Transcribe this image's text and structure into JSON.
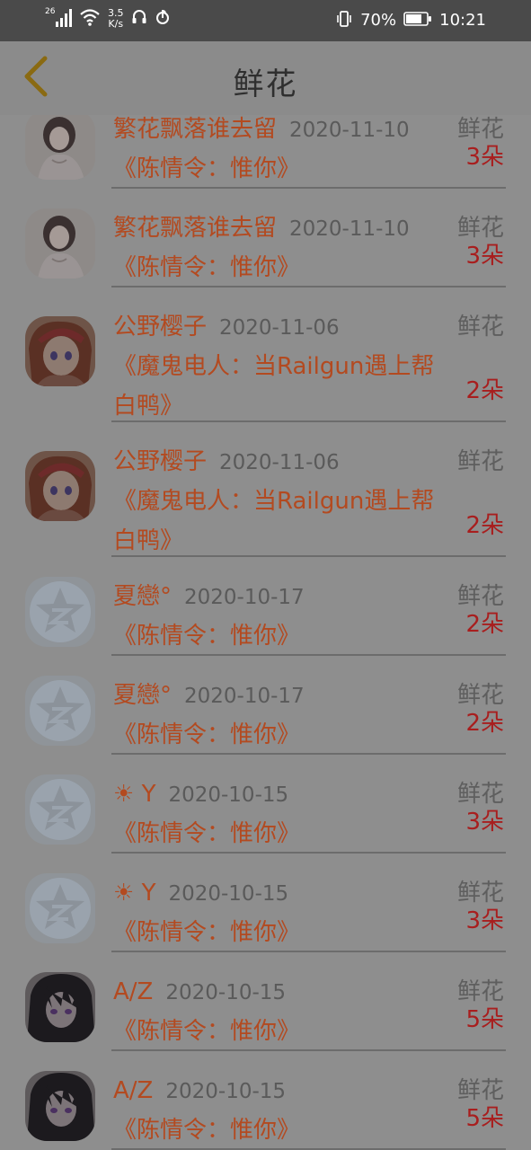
{
  "status_bar": {
    "signal_type": "26",
    "net_speed_value": "3.5",
    "net_speed_unit": "K/s",
    "battery_percent": "70%",
    "time": "10:21"
  },
  "header": {
    "title": "鲜花"
  },
  "records": [
    {
      "name": "繁花飘落谁去留",
      "date": "2020-11-10",
      "type": "鲜花",
      "book": "《陈情令：惟你》",
      "count": "3朵",
      "avatar": "girl-photo"
    },
    {
      "name": "繁花飘落谁去留",
      "date": "2020-11-10",
      "type": "鲜花",
      "book": "《陈情令：惟你》",
      "count": "3朵",
      "avatar": "girl-photo"
    },
    {
      "name": "公野樱子",
      "date": "2020-11-06",
      "type": "鲜花",
      "book": "《魔鬼电人：当Railgun遇上帮白鸭》",
      "count": "2朵",
      "avatar": "anime-girl"
    },
    {
      "name": "公野樱子",
      "date": "2020-11-06",
      "type": "鲜花",
      "book": "《魔鬼电人：当Railgun遇上帮白鸭》",
      "count": "2朵",
      "avatar": "anime-girl"
    },
    {
      "name": "夏戀°",
      "date": "2020-10-17",
      "type": "鲜花",
      "book": "《陈情令：惟你》",
      "count": "2朵",
      "avatar": "default-star"
    },
    {
      "name": "夏戀°",
      "date": "2020-10-17",
      "type": "鲜花",
      "book": "《陈情令：惟你》",
      "count": "2朵",
      "avatar": "default-star"
    },
    {
      "name": "☀ Y",
      "date": "2020-10-15",
      "type": "鲜花",
      "book": "《陈情令：惟你》",
      "count": "3朵",
      "avatar": "default-star"
    },
    {
      "name": "☀ Y",
      "date": "2020-10-15",
      "type": "鲜花",
      "book": "《陈情令：惟你》",
      "count": "3朵",
      "avatar": "default-star"
    },
    {
      "name": "A/Z",
      "date": "2020-10-15",
      "type": "鲜花",
      "book": "《陈情令：惟你》",
      "count": "5朵",
      "avatar": "dark-anime"
    },
    {
      "name": "A/Z",
      "date": "2020-10-15",
      "type": "鲜花",
      "book": "《陈情令：惟你》",
      "count": "5朵",
      "avatar": "dark-anime"
    }
  ],
  "colors": {
    "overlay_bg": "#8e8e8e",
    "name_text": "#b34a20",
    "count_text": "#a81e1e",
    "back_arrow": "#8a6a12"
  }
}
